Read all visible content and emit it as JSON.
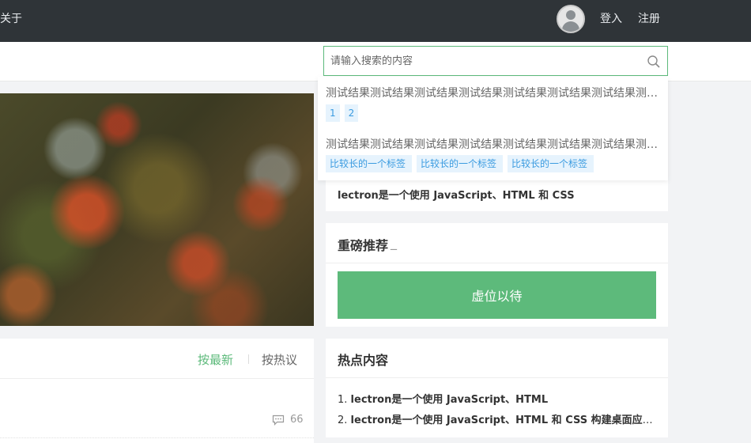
{
  "nav": {
    "about_label": "关于",
    "login_label": "登入",
    "register_label": "注册"
  },
  "search": {
    "placeholder": "请输入搜索的内容",
    "results": [
      {
        "title": "测试结果测试结果测试结果测试结果测试结果测试结果测试结果测试结果测试结果",
        "tags": [
          "1",
          "2"
        ]
      },
      {
        "title": "测试结果测试结果测试结果测试结果测试结果测试结果测试结果测试结果测试结果",
        "tags": [
          "比较长的一个标签",
          "比较长的一个标签",
          "比较长的一个标签"
        ]
      }
    ]
  },
  "sort": {
    "newest_label": "按最新",
    "hottest_label": "按热议"
  },
  "post": {
    "comment_count": "66"
  },
  "right": {
    "top_card_text": "lectron是一个使用 JavaScript、HTML 和 CSS",
    "recommend_title": "重磅推荐",
    "recommend_suffix": "_",
    "placeholder_text": "虚位以待",
    "hot_title": "热点内容",
    "hot_items": [
      {
        "index": "1.",
        "text": "lectron是一个使用 JavaScript、HTML"
      },
      {
        "index": "2.",
        "text": "lectron是一个使用 JavaScript、HTML 和 CSS 构建桌面应用程序的框架"
      }
    ]
  },
  "colors": {
    "accent_green": "#5dba7b",
    "nav_bg": "#2f3438",
    "tag_bg": "#e6f3fd",
    "tag_text": "#3a9be0"
  },
  "icons": {
    "search": "search-icon",
    "comment": "comment-icon",
    "avatar": "user-avatar-icon"
  }
}
